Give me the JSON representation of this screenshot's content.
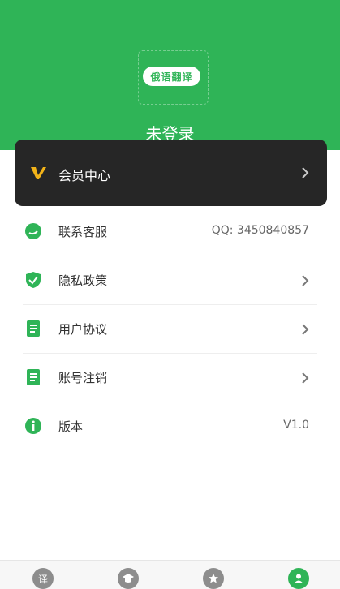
{
  "header": {
    "logo_text": "俄语翻译",
    "login_status": "未登录"
  },
  "vip": {
    "label": "会员中心"
  },
  "menu": {
    "items": [
      {
        "label": "联系客服",
        "value": "QQ:  3450840857",
        "icon": "chat-bubble-icon"
      },
      {
        "label": "隐私政策",
        "icon": "shield-check-icon"
      },
      {
        "label": "用户协议",
        "icon": "document-icon"
      },
      {
        "label": "账号注销",
        "icon": "document-icon"
      },
      {
        "label": "版本",
        "value": "V1.0",
        "icon": "info-icon"
      }
    ]
  },
  "tabbar": {
    "tabs": [
      {
        "label": "译",
        "icon": "translate-icon",
        "active": false
      },
      {
        "icon": "graduation-cap-icon",
        "active": false
      },
      {
        "icon": "star-icon",
        "active": false
      },
      {
        "icon": "user-icon",
        "active": true
      }
    ]
  },
  "colors": {
    "brand_green": "#2fb457",
    "vip_dark": "#262626",
    "vip_gold": "#f2b319"
  }
}
